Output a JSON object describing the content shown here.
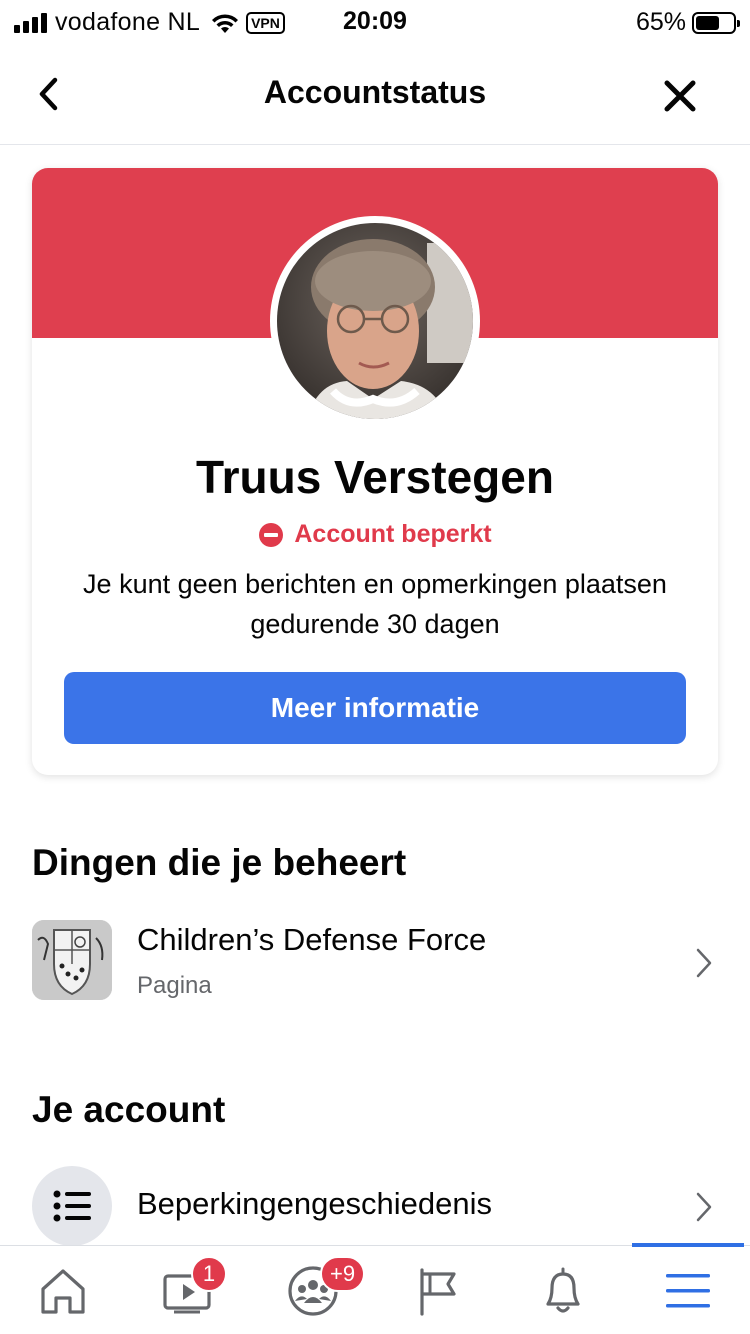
{
  "colors": {
    "banner": "#df3f4f",
    "restriction": "#e03a4b",
    "primary_button": "#3b74e8",
    "active_tab": "#2f6fe4",
    "badge": "#e03a4b"
  },
  "status_bar": {
    "carrier": "vodafone NL",
    "vpn": "VPN",
    "time": "20:09",
    "battery": "65%",
    "battery_level": 0.65
  },
  "header": {
    "title": "Accountstatus",
    "back_icon": "chevron-left-icon",
    "close_icon": "close-icon"
  },
  "profile": {
    "name": "Truus Verstegen",
    "status_icon": "no-entry-icon",
    "status": "Account beperkt",
    "description": "Je kunt geen berichten en opmerkingen plaatsen gedurende 30 dagen",
    "button": "Meer informatie"
  },
  "managed": {
    "heading": "Dingen die je beheert",
    "items": [
      {
        "title": "Children’s Defense Force",
        "subtitle": "Pagina"
      }
    ]
  },
  "account": {
    "heading": "Je account",
    "items": [
      {
        "title": "Beperkingengeschiedenis",
        "icon": "list-icon"
      }
    ]
  },
  "tab_bar": {
    "tabs": [
      {
        "icon": "home-icon",
        "badge": ""
      },
      {
        "icon": "video-icon",
        "badge": "1"
      },
      {
        "icon": "groups-icon",
        "badge": "+9"
      },
      {
        "icon": "flag-icon",
        "badge": ""
      },
      {
        "icon": "bell-icon",
        "badge": ""
      },
      {
        "icon": "menu-icon",
        "badge": "",
        "active": true
      }
    ]
  }
}
